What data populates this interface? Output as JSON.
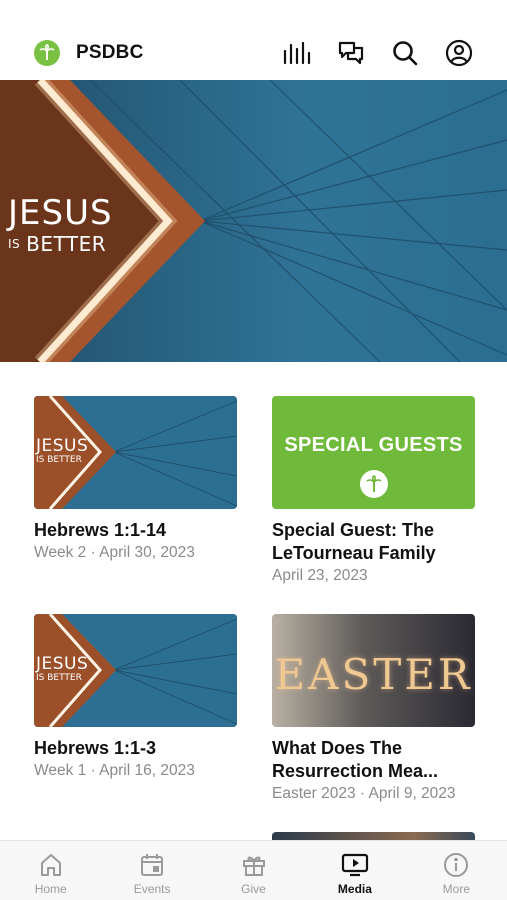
{
  "header": {
    "brand_name": "PSDBC",
    "icons": [
      "bars-icon",
      "chat-icon",
      "search-icon",
      "profile-icon"
    ]
  },
  "hero": {
    "title": "JESUS",
    "sub_is": "IS",
    "sub_better": "BETTER"
  },
  "cards": [
    {
      "title": "Hebrews 1:1-14",
      "subtitle": "Week 2 · April 30, 2023",
      "thumb_title": "JESUS",
      "thumb_sub": "IS BETTER"
    },
    {
      "title": "Special Guest: The LeTourneau Family",
      "subtitle": "April 23, 2023",
      "thumb_text": "SPECIAL GUESTS"
    },
    {
      "title": "Hebrews 1:1-3",
      "subtitle": "Week 1 · April 16, 2023",
      "thumb_title": "JESUS",
      "thumb_sub": "IS BETTER"
    },
    {
      "title": "What Does The Resurrection Mea...",
      "subtitle": "Easter 2023 · April 9, 2023",
      "thumb_text": "EASTER"
    }
  ],
  "tabs": [
    {
      "label": "Home",
      "icon": "home-icon"
    },
    {
      "label": "Events",
      "icon": "calendar-icon"
    },
    {
      "label": "Give",
      "icon": "gift-icon"
    },
    {
      "label": "Media",
      "icon": "play-tv-icon"
    },
    {
      "label": "More",
      "icon": "info-icon"
    }
  ],
  "colors": {
    "accent_green": "#7ac143",
    "hero_blue": "#2d6e93",
    "copper": "#b0623a"
  }
}
